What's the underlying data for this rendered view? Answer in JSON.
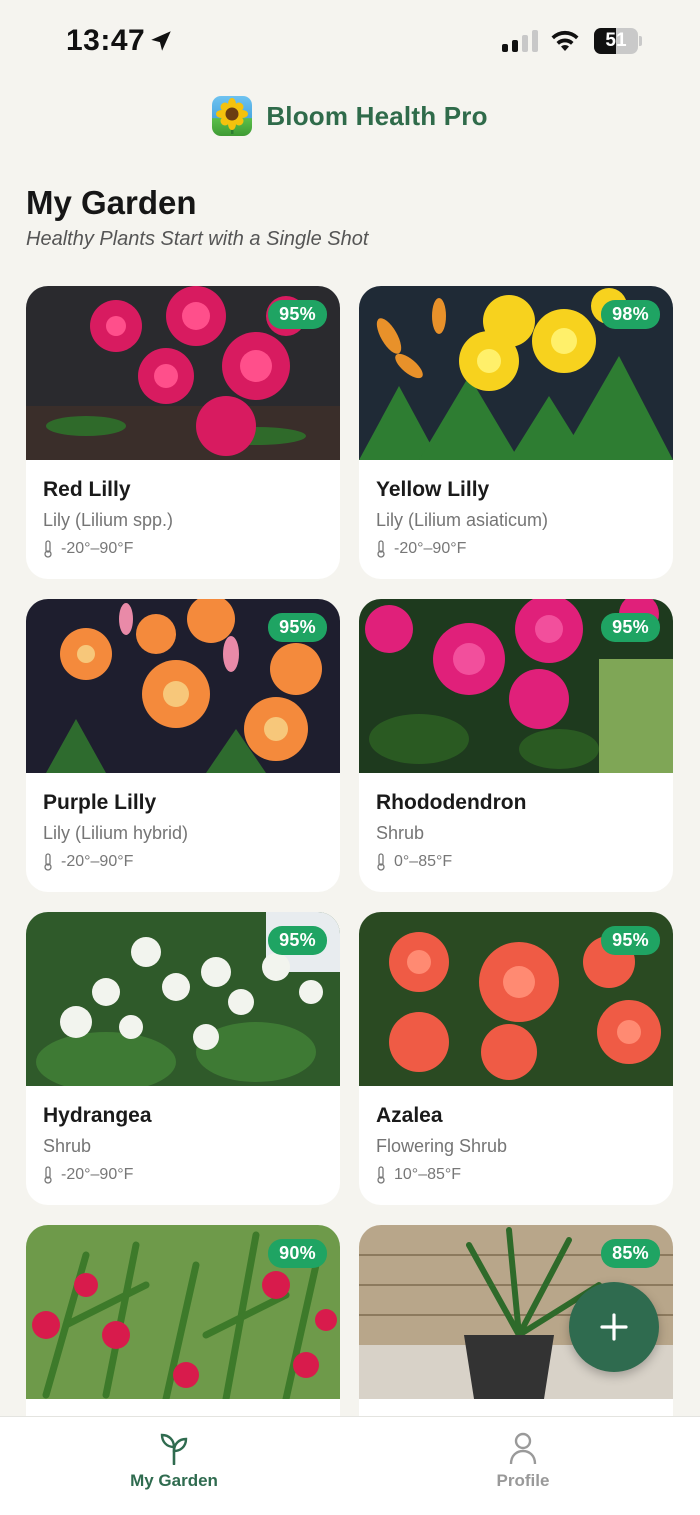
{
  "status_bar": {
    "time": "13:47",
    "battery": "51"
  },
  "header": {
    "app_name": "Bloom Health Pro",
    "logo_icon": "sunflower-icon"
  },
  "page": {
    "title": "My Garden",
    "subtitle": "Healthy Plants Start with a Single Shot"
  },
  "plants": [
    {
      "name": "Red Lilly",
      "species": "Lily (Lilium spp.)",
      "temp": "-20°–90°F",
      "health": "95%",
      "photo": "red-lily-photo"
    },
    {
      "name": "Yellow Lilly",
      "species": "Lily (Lilium asiaticum)",
      "temp": "-20°–90°F",
      "health": "98%",
      "photo": "yellow-lily-photo"
    },
    {
      "name": "Purple Lilly",
      "species": "Lily (Lilium hybrid)",
      "temp": "-20°–90°F",
      "health": "95%",
      "photo": "orange-lily-photo"
    },
    {
      "name": "Rhododendron",
      "species": "Shrub",
      "temp": "0°–85°F",
      "health": "95%",
      "photo": "rhododendron-photo"
    },
    {
      "name": "Hydrangea",
      "species": "Shrub",
      "temp": "-20°–90°F",
      "health": "95%",
      "photo": "hydrangea-photo"
    },
    {
      "name": "Azalea",
      "species": "Flowering Shrub",
      "temp": "10°–85°F",
      "health": "95%",
      "photo": "azalea-photo"
    },
    {
      "name": "",
      "species": "",
      "temp": "",
      "health": "90%",
      "photo": "oleander-photo"
    },
    {
      "name": "",
      "species": "",
      "temp": "",
      "health": "85%",
      "photo": "potted-plant-photo"
    }
  ],
  "fab": {
    "icon": "plus-icon"
  },
  "tabs": [
    {
      "label": "My Garden",
      "icon": "sprout-icon",
      "active": true
    },
    {
      "label": "Profile",
      "icon": "person-icon",
      "active": false
    }
  ],
  "colors": {
    "background": "#f5f4ef",
    "brand_green": "#2f6b4f",
    "badge_green": "#1fa463"
  }
}
